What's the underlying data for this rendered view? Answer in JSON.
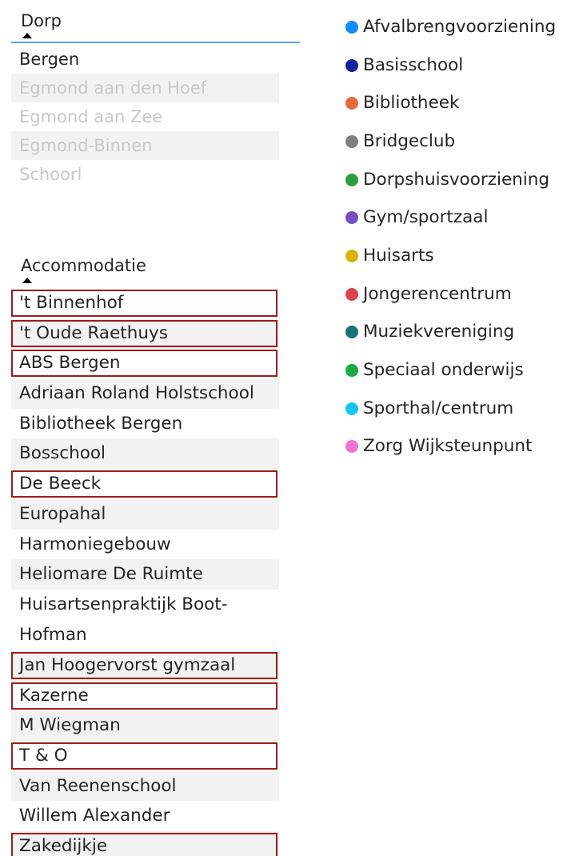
{
  "dorp_slicer": {
    "title": "Dorp",
    "items": [
      {
        "label": "Bergen",
        "disabled": false
      },
      {
        "label": "Egmond aan den Hoef",
        "disabled": true
      },
      {
        "label": "Egmond aan Zee",
        "disabled": true
      },
      {
        "label": "Egmond-Binnen",
        "disabled": true
      },
      {
        "label": "Schoorl",
        "disabled": true
      }
    ]
  },
  "accommodatie_slicer": {
    "title": "Accommodatie",
    "items": [
      {
        "label": "'t Binnenhof",
        "highlighted": true
      },
      {
        "label": "'t Oude Raethuys",
        "highlighted": true
      },
      {
        "label": "ABS Bergen",
        "highlighted": true
      },
      {
        "label": "Adriaan Roland Holstschool",
        "highlighted": false
      },
      {
        "label": "Bibliotheek Bergen",
        "highlighted": false
      },
      {
        "label": "Bosschool",
        "highlighted": false
      },
      {
        "label": "De Beeck",
        "highlighted": true
      },
      {
        "label": "Europahal",
        "highlighted": false
      },
      {
        "label": "Harmoniegebouw",
        "highlighted": false
      },
      {
        "label": "Heliomare De Ruimte",
        "highlighted": false
      },
      {
        "label": "Huisartsenpraktijk Boot-Hofman",
        "highlighted": false
      },
      {
        "label": "Jan Hoogervorst gymzaal",
        "highlighted": true
      },
      {
        "label": "Kazerne",
        "highlighted": true
      },
      {
        "label": "M Wiegman",
        "highlighted": false
      },
      {
        "label": "T & O",
        "highlighted": true
      },
      {
        "label": "Van Reenenschool",
        "highlighted": false
      },
      {
        "label": "Willem Alexander",
        "highlighted": false
      },
      {
        "label": "Zakedijkje",
        "highlighted": true
      }
    ]
  },
  "legend": {
    "items": [
      {
        "label": "Afvalbrengvoorziening",
        "color": "#118dff"
      },
      {
        "label": "Basisschool",
        "color": "#12239e"
      },
      {
        "label": "Bibliotheek",
        "color": "#e66c37"
      },
      {
        "label": "Bridgeclub",
        "color": "#7f7f7f"
      },
      {
        "label": "Dorpshuisvoorziening",
        "color": "#2e9e3a"
      },
      {
        "label": "Gym/sportzaal",
        "color": "#744ec2"
      },
      {
        "label": "Huisarts",
        "color": "#d9b300"
      },
      {
        "label": "Jongerencentrum",
        "color": "#d64550"
      },
      {
        "label": "Muziekvereniging",
        "color": "#197278"
      },
      {
        "label": "Speciaal onderwijs",
        "color": "#1aab40"
      },
      {
        "label": "Sporthal/centrum",
        "color": "#15c6f4"
      },
      {
        "label": "Zorg Wijksteunpunt",
        "color": "#f472d0"
      }
    ]
  }
}
